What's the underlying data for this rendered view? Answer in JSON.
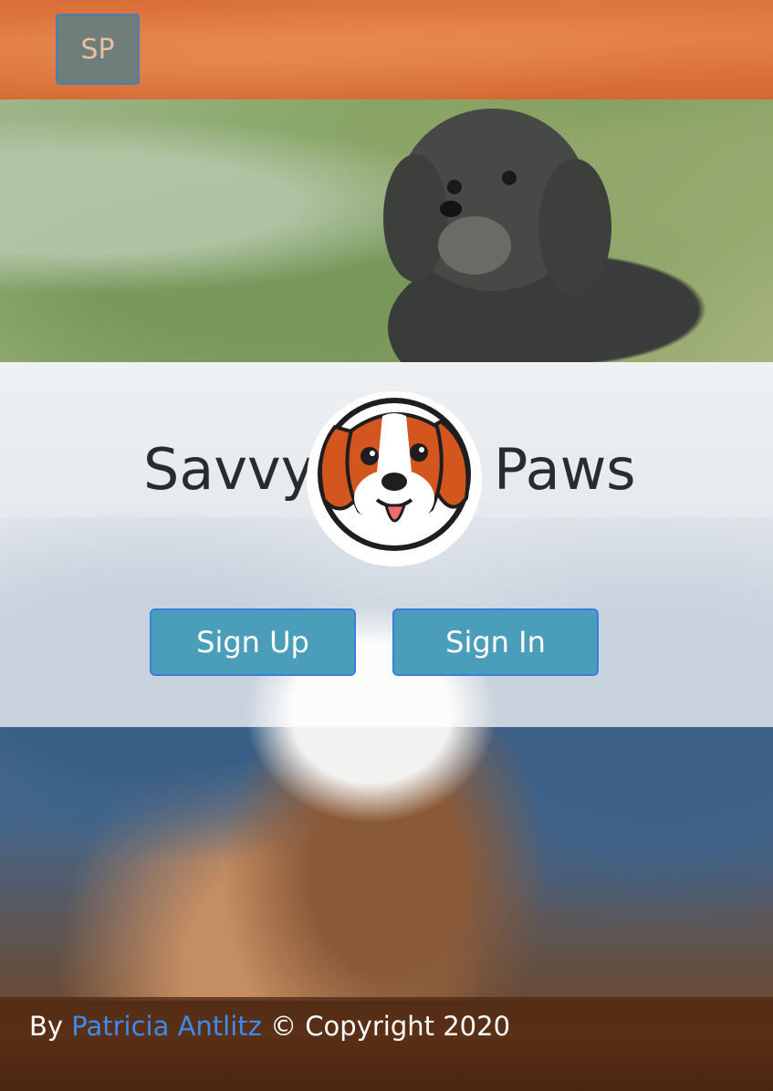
{
  "header": {
    "logo_label": "SP",
    "color": "#e07a40"
  },
  "hero": {
    "brand_left": "Savvy",
    "brand_right": "Paws",
    "mascot_icon": "beagle-mascot-icon"
  },
  "actions": {
    "signup_label": "Sign Up",
    "signin_label": "Sign In",
    "button_color": "#4b9eba"
  },
  "footer": {
    "by_text": "By",
    "author": "Patricia Antlitz",
    "copyright": "© Copyright 2020",
    "link_color": "#3d8bf0"
  }
}
